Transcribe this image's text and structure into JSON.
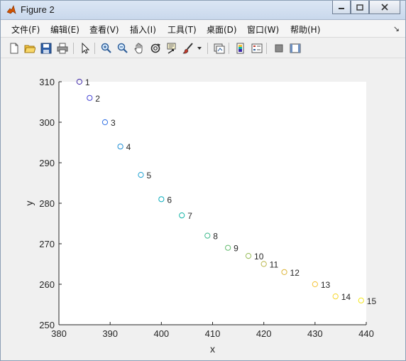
{
  "window": {
    "title": "Figure 2"
  },
  "menu": [
    "文件(F)",
    "编辑(E)",
    "查看(V)",
    "插入(I)",
    "工具(T)",
    "桌面(D)",
    "窗口(W)",
    "帮助(H)"
  ],
  "toolbar": {
    "icons": [
      "new-figure-icon",
      "open-file-icon",
      "save-icon",
      "print-icon",
      "edit-plot-arrow-icon",
      "zoom-in-icon",
      "zoom-out-icon",
      "pan-hand-icon",
      "rotate-3d-icon",
      "data-cursor-icon",
      "brush-icon",
      "brush-dropdown-icon",
      "link-plot-icon",
      "insert-colorbar-icon",
      "insert-legend-icon",
      "hide-plot-tools-icon",
      "show-plot-tools-icon"
    ]
  },
  "chart_data": {
    "type": "scatter",
    "title": "",
    "xlabel": "x",
    "ylabel": "y",
    "xlim": [
      380,
      440
    ],
    "ylim": [
      250,
      310
    ],
    "xticks": [
      380,
      390,
      400,
      410,
      420,
      430,
      440
    ],
    "yticks": [
      250,
      260,
      270,
      280,
      290,
      300,
      310
    ],
    "grid": false,
    "marker": "open-circle",
    "colormap": "parula",
    "points": [
      {
        "label": "1",
        "x": 384,
        "y": 310,
        "color": "#3e26a8"
      },
      {
        "label": "2",
        "x": 386,
        "y": 306,
        "color": "#4443d4"
      },
      {
        "label": "3",
        "x": 389,
        "y": 300,
        "color": "#2d6ee3"
      },
      {
        "label": "4",
        "x": 392,
        "y": 294,
        "color": "#1f8fd6"
      },
      {
        "label": "5",
        "x": 396,
        "y": 287,
        "color": "#1ba0d2"
      },
      {
        "label": "6",
        "x": 400,
        "y": 281,
        "color": "#0caebe"
      },
      {
        "label": "7",
        "x": 404,
        "y": 277,
        "color": "#10b3a5"
      },
      {
        "label": "8",
        "x": 409,
        "y": 272,
        "color": "#3ab88a"
      },
      {
        "label": "9",
        "x": 413,
        "y": 269,
        "color": "#63bb6e"
      },
      {
        "label": "10",
        "x": 417,
        "y": 267,
        "color": "#94ba54"
      },
      {
        "label": "11",
        "x": 420,
        "y": 265,
        "color": "#b9b548"
      },
      {
        "label": "12",
        "x": 424,
        "y": 263,
        "color": "#dcb437"
      },
      {
        "label": "13",
        "x": 430,
        "y": 260,
        "color": "#f4c232"
      },
      {
        "label": "14",
        "x": 434,
        "y": 257,
        "color": "#f6d628"
      },
      {
        "label": "15",
        "x": 439,
        "y": 256,
        "color": "#f4e71e"
      }
    ]
  }
}
